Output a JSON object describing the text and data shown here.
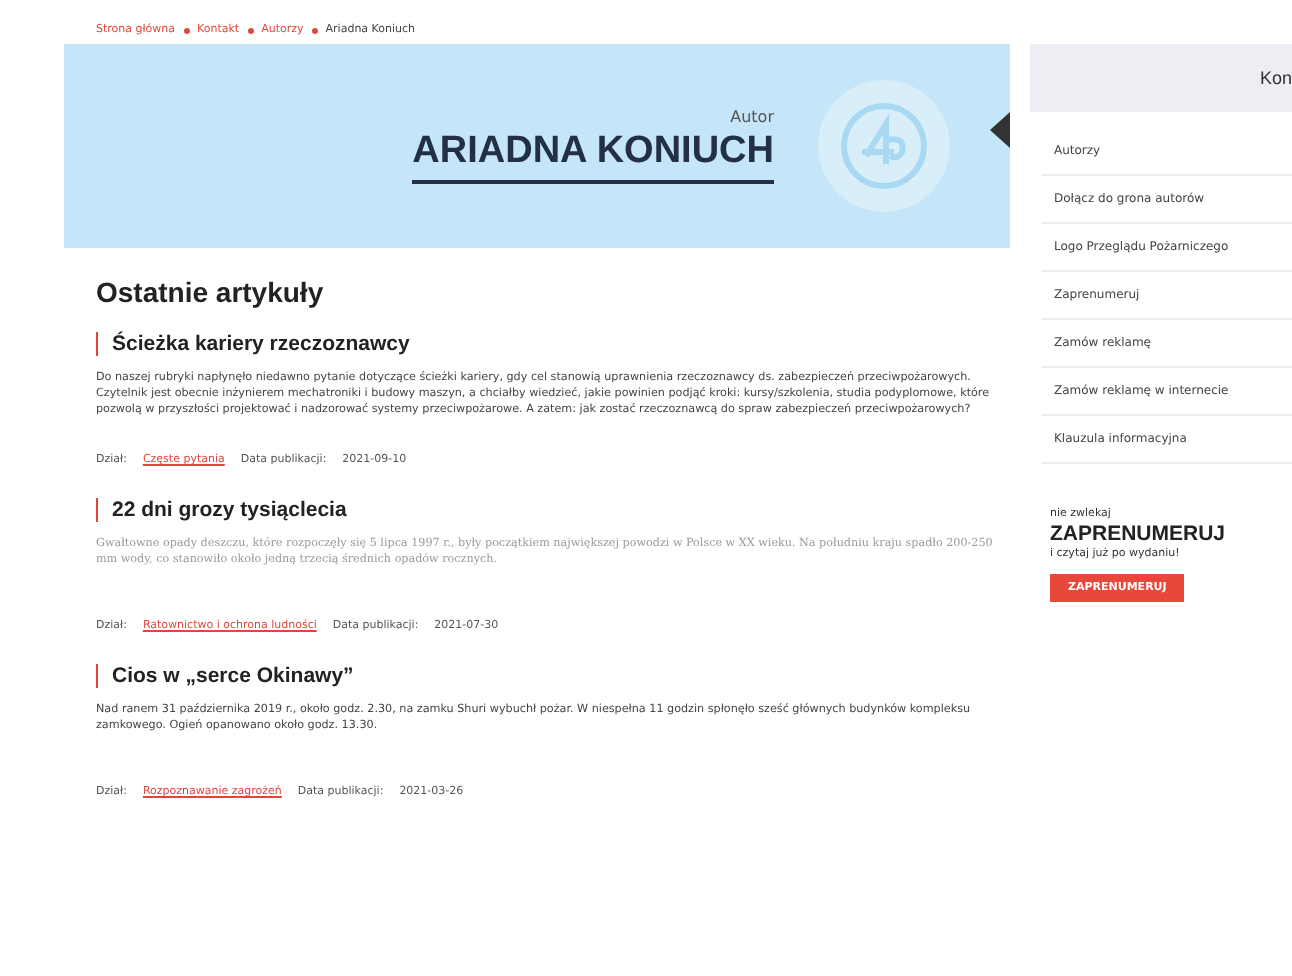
{
  "breadcrumb": [
    {
      "label": "Strona główna",
      "current": false
    },
    {
      "label": "Kontakt",
      "current": false
    },
    {
      "label": "Autorzy",
      "current": false
    },
    {
      "label": "Ariadna Koniuch",
      "current": true
    }
  ],
  "author": {
    "role": "Autor",
    "name": "ARIADNA KONIUCH"
  },
  "section_title": "Ostatnie artykuły",
  "articles": [
    {
      "title": "Ścieżka kariery rzeczoznawcy",
      "serif": false,
      "excerpt": "Do naszej rubryki napłynęło niedawno pytanie dotyczące ścieżki kariery, gdy cel stanowią uprawnienia rzeczoznawcy ds. zabezpieczeń przeciwpożarowych. Czytelnik jest obecnie inżynierem mechatroniki i budowy maszyn, a chciałby wiedzieć, jakie powinien podjąć kroki: kursy/szkolenia, studia podyplomowe, które pozwolą w przyszłości projektować i nadzorować systemy przeciwpożarowe. A zatem: jak zostać rzeczoznawcą do spraw zabezpieczeń przeciwpożarowych?",
      "section_label": "Dział:",
      "section": "Częste pytania",
      "date_label": "Data publikacji:",
      "date": "2021-09-10"
    },
    {
      "title": "22 dni grozy tysiąclecia",
      "serif": true,
      "excerpt": "Gwałtowne opady deszczu, które rozpoczęły się 5 lipca 1997 r., były początkiem największej powodzi w Polsce w XX wieku. Na południu kraju spadło 200-250 mm wody, co stanowiło około jedną trzecią średnich opadów rocznych.",
      "section_label": "Dział:",
      "section": "Ratownictwo i ochrona ludności",
      "date_label": "Data publikacji:",
      "date": "2021-07-30"
    },
    {
      "title": "Cios w „serce Okinawy”",
      "serif": false,
      "excerpt": "Nad ranem 31 października 2019 r., około godz. 2.30, na zamku Shuri wybuchł pożar. W niespełna 11 godzin spłonęło sześć głównych budynków kompleksu zamkowego. Ogień opanowano około godz. 13.30.",
      "section_label": "Dział:",
      "section": "Rozpoznawanie zagrożeń",
      "date_label": "Data publikacji:",
      "date": "2021-03-26"
    }
  ],
  "sidebar": {
    "title": "Kon",
    "items": [
      "Autorzy",
      "Dołącz do grona autorów",
      "Logo Przeglądu Pożarniczego",
      "Zaprenumeruj",
      "Zamów reklamę",
      "Zamów reklamę w internecie",
      "Klauzula informacyjna"
    ]
  },
  "subscribe": {
    "kicker": "nie zwlekaj",
    "title": "ZAPRENUMERUJ",
    "subtitle": "i czytaj już po wydaniu!",
    "button": "ZAPRENUMERUJ"
  }
}
